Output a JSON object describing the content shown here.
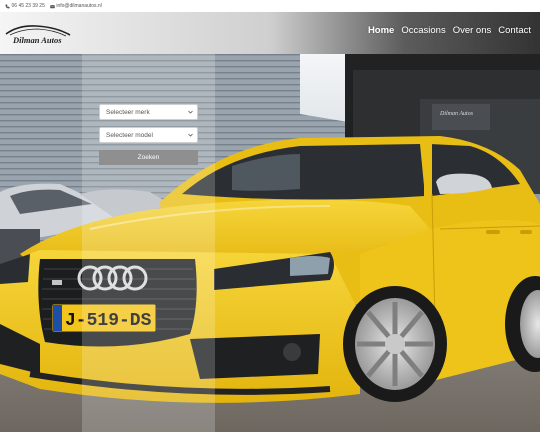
{
  "topbar": {
    "phone": "06 45 23 39 25",
    "email": "info@dilmanautos.nl",
    "phone_icon": "phone-icon",
    "email_icon": "envelope-icon"
  },
  "header": {
    "logo_text": "Dilman Autos",
    "nav": [
      {
        "label": "Home",
        "active": true
      },
      {
        "label": "Occasions",
        "active": false
      },
      {
        "label": "Over ons",
        "active": false
      },
      {
        "label": "Contact",
        "active": false
      }
    ]
  },
  "search": {
    "brand_placeholder": "Selecteer merk",
    "model_placeholder": "Selecteer model",
    "button_label": "Zoeken"
  },
  "hero": {
    "license_plate": "J-519-DS",
    "dealership_sign": "Dilman Autos"
  },
  "colors": {
    "car_yellow": "#f2c91c",
    "search_button": "#8f8f8f",
    "header_dark": "#333333"
  }
}
